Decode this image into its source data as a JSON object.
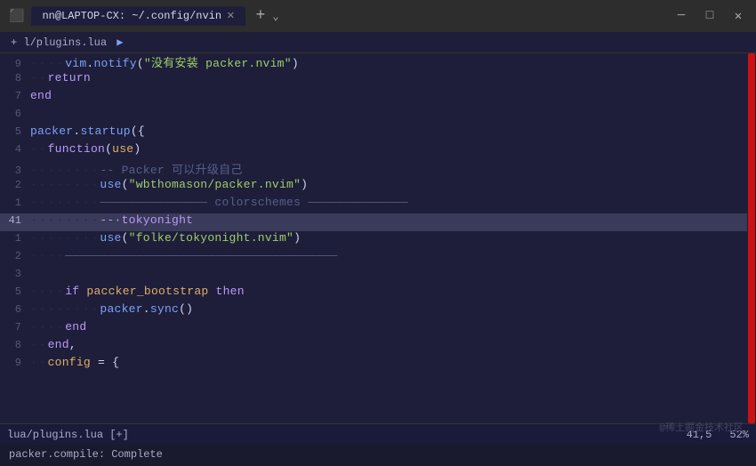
{
  "titlebar": {
    "icon": "terminal",
    "tab_label": "nn@LAPTOP-CX: ~/.config/nvin",
    "plus_label": "+",
    "arrow_label": "⌄",
    "min_label": "─",
    "max_label": "□",
    "close_label": "✕"
  },
  "filepath": "+ l/plugins.lua",
  "lines": [
    {
      "num": "9",
      "content_raw": "9_vim.notify_chinese_str",
      "active": false
    },
    {
      "num": "8",
      "content_raw": "8_return",
      "active": false
    },
    {
      "num": "7",
      "content_raw": "7_end",
      "active": false
    },
    {
      "num": "6",
      "content_raw": "6_empty",
      "active": false
    },
    {
      "num": "5",
      "content_raw": "5_packer_startup",
      "active": false
    },
    {
      "num": "4",
      "content_raw": "4_function_use",
      "active": false
    },
    {
      "num": "3",
      "content_raw": "3_packer_upgrade_cmt",
      "active": false
    },
    {
      "num": "2",
      "content_raw": "2_use_packer",
      "active": false
    },
    {
      "num": "1",
      "content_raw": "1_colorschemes_cmt",
      "active": false
    },
    {
      "num": "41",
      "content_raw": "41_tokyonight_cmt",
      "active": true
    },
    {
      "num": "1",
      "content_raw": "1_use_tokyonight",
      "active": false
    },
    {
      "num": "2",
      "content_raw": "2_empty_line",
      "active": false
    },
    {
      "num": "3",
      "content_raw": "3_empty",
      "active": false
    },
    {
      "num": "5",
      "content_raw": "5_if_packer_bootstrap",
      "active": false
    },
    {
      "num": "6",
      "content_raw": "6_packer_sync",
      "active": false
    },
    {
      "num": "7",
      "content_raw": "7_end",
      "active": false
    },
    {
      "num": "8",
      "content_raw": "8_end_comma",
      "active": false
    },
    {
      "num": "9",
      "content_raw": "9_config_eq",
      "active": false
    }
  ],
  "statusbar": {
    "left": "lua/plugins.lua [+]",
    "position": "41,5",
    "percent": "52%"
  },
  "output": "packer.compile: Complete",
  "watermark": "@稀土掘金技术社区"
}
